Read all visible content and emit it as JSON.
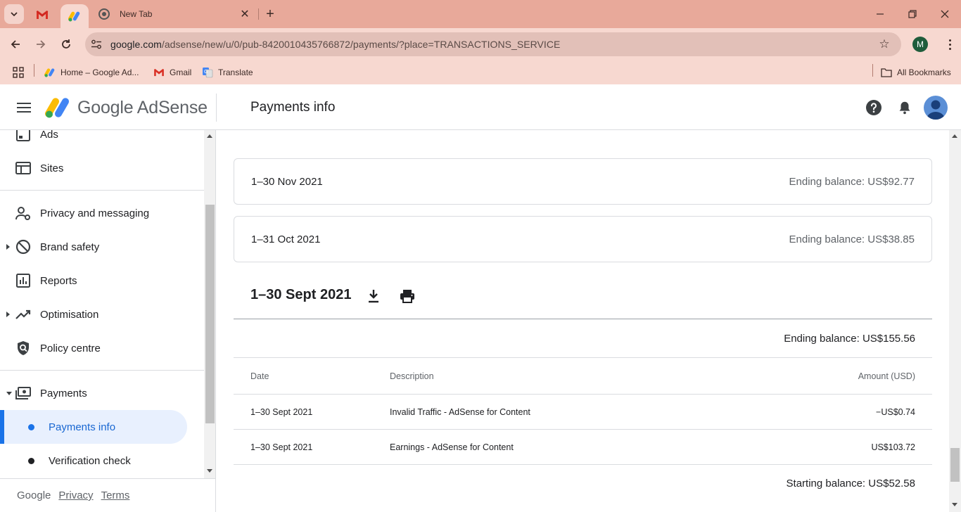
{
  "browser": {
    "tabs": [
      {
        "title": "Gmail",
        "icon": "gmail-icon"
      },
      {
        "title": "Google AdSense",
        "icon": "adsense-icon",
        "active": true
      },
      {
        "title": "New Tab",
        "icon": "chrome-icon"
      }
    ],
    "new_tab_title": "New Tab",
    "url_host": "google.com",
    "url_path": "/adsense/new/u/0/pub-8420010435766872/payments/?place=TRANSACTIONS_SERVICE",
    "profile_initial": "M",
    "bookmarks": [
      {
        "label": "Home – Google Ad...",
        "icon": "adsense-icon"
      },
      {
        "label": "Gmail",
        "icon": "gmail-icon"
      },
      {
        "label": "Translate",
        "icon": "translate-icon"
      }
    ],
    "all_bookmarks": "All Bookmarks"
  },
  "app": {
    "logo_text": "Google AdSense",
    "page_title": "Payments info"
  },
  "sidebar": {
    "items": [
      {
        "label": "Ads",
        "icon": "ads-icon"
      },
      {
        "label": "Sites",
        "icon": "sites-icon"
      },
      {
        "label": "Privacy and messaging",
        "icon": "privacy-icon"
      },
      {
        "label": "Brand safety",
        "icon": "block-icon"
      },
      {
        "label": "Reports",
        "icon": "reports-icon"
      },
      {
        "label": "Optimisation",
        "icon": "trending-icon"
      },
      {
        "label": "Policy centre",
        "icon": "policy-icon"
      },
      {
        "label": "Payments",
        "icon": "payments-icon"
      }
    ],
    "sub_items": [
      {
        "label": "Payments info",
        "active": true
      },
      {
        "label": "Verification check"
      }
    ],
    "footer": {
      "brand": "Google",
      "privacy": "Privacy",
      "terms": "Terms"
    }
  },
  "main": {
    "months": [
      {
        "period": "1–30 Nov 2021",
        "balance": "Ending balance: US$92.77"
      },
      {
        "period": "1–31 Oct 2021",
        "balance": "Ending balance: US$38.85"
      }
    ],
    "expanded": {
      "period": "1–30 Sept 2021",
      "ending_balance": "Ending balance: US$155.56",
      "starting_balance": "Starting balance: US$52.58",
      "headers": {
        "date": "Date",
        "description": "Description",
        "amount": "Amount (USD)"
      },
      "rows": [
        {
          "date": "1–30 Sept 2021",
          "description": "Invalid Traffic - AdSense for Content",
          "amount": "−US$0.74"
        },
        {
          "date": "1–30 Sept 2021",
          "description": "Earnings - AdSense for Content",
          "amount": "US$103.72"
        }
      ]
    }
  },
  "colors": {
    "tabbar": "#e8a99a",
    "toolbar": "#f7d8d0",
    "accent": "#1a73e8",
    "active_bg": "#e8f0fe"
  }
}
